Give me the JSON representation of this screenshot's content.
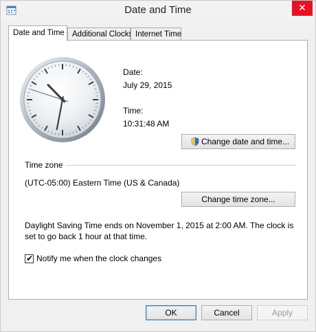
{
  "window": {
    "title": "Date and Time",
    "close_label": "✕"
  },
  "tabs": [
    {
      "label": "Date and Time",
      "active": true
    },
    {
      "label": "Additional Clocks",
      "active": false
    },
    {
      "label": "Internet Time",
      "active": false
    }
  ],
  "datetime": {
    "date_label": "Date:",
    "date_value": "July 29, 2015",
    "time_label": "Time:",
    "time_value": "10:31:48 AM",
    "change_button": "Change date and time..."
  },
  "clock": {
    "hour": 10,
    "minute": 31,
    "second": 48
  },
  "timezone": {
    "heading": "Time zone",
    "value": "(UTC-05:00) Eastern Time (US & Canada)",
    "change_button": "Change time zone..."
  },
  "dst": {
    "text_line1": "Daylight Saving Time ends on November 1, 2015 at 2:00 AM. The clock is",
    "text_line2": "set to go back 1 hour at that time."
  },
  "notify": {
    "label": "Notify me when the clock changes",
    "checked": true
  },
  "footer": {
    "ok": "OK",
    "cancel": "Cancel",
    "apply": "Apply"
  }
}
